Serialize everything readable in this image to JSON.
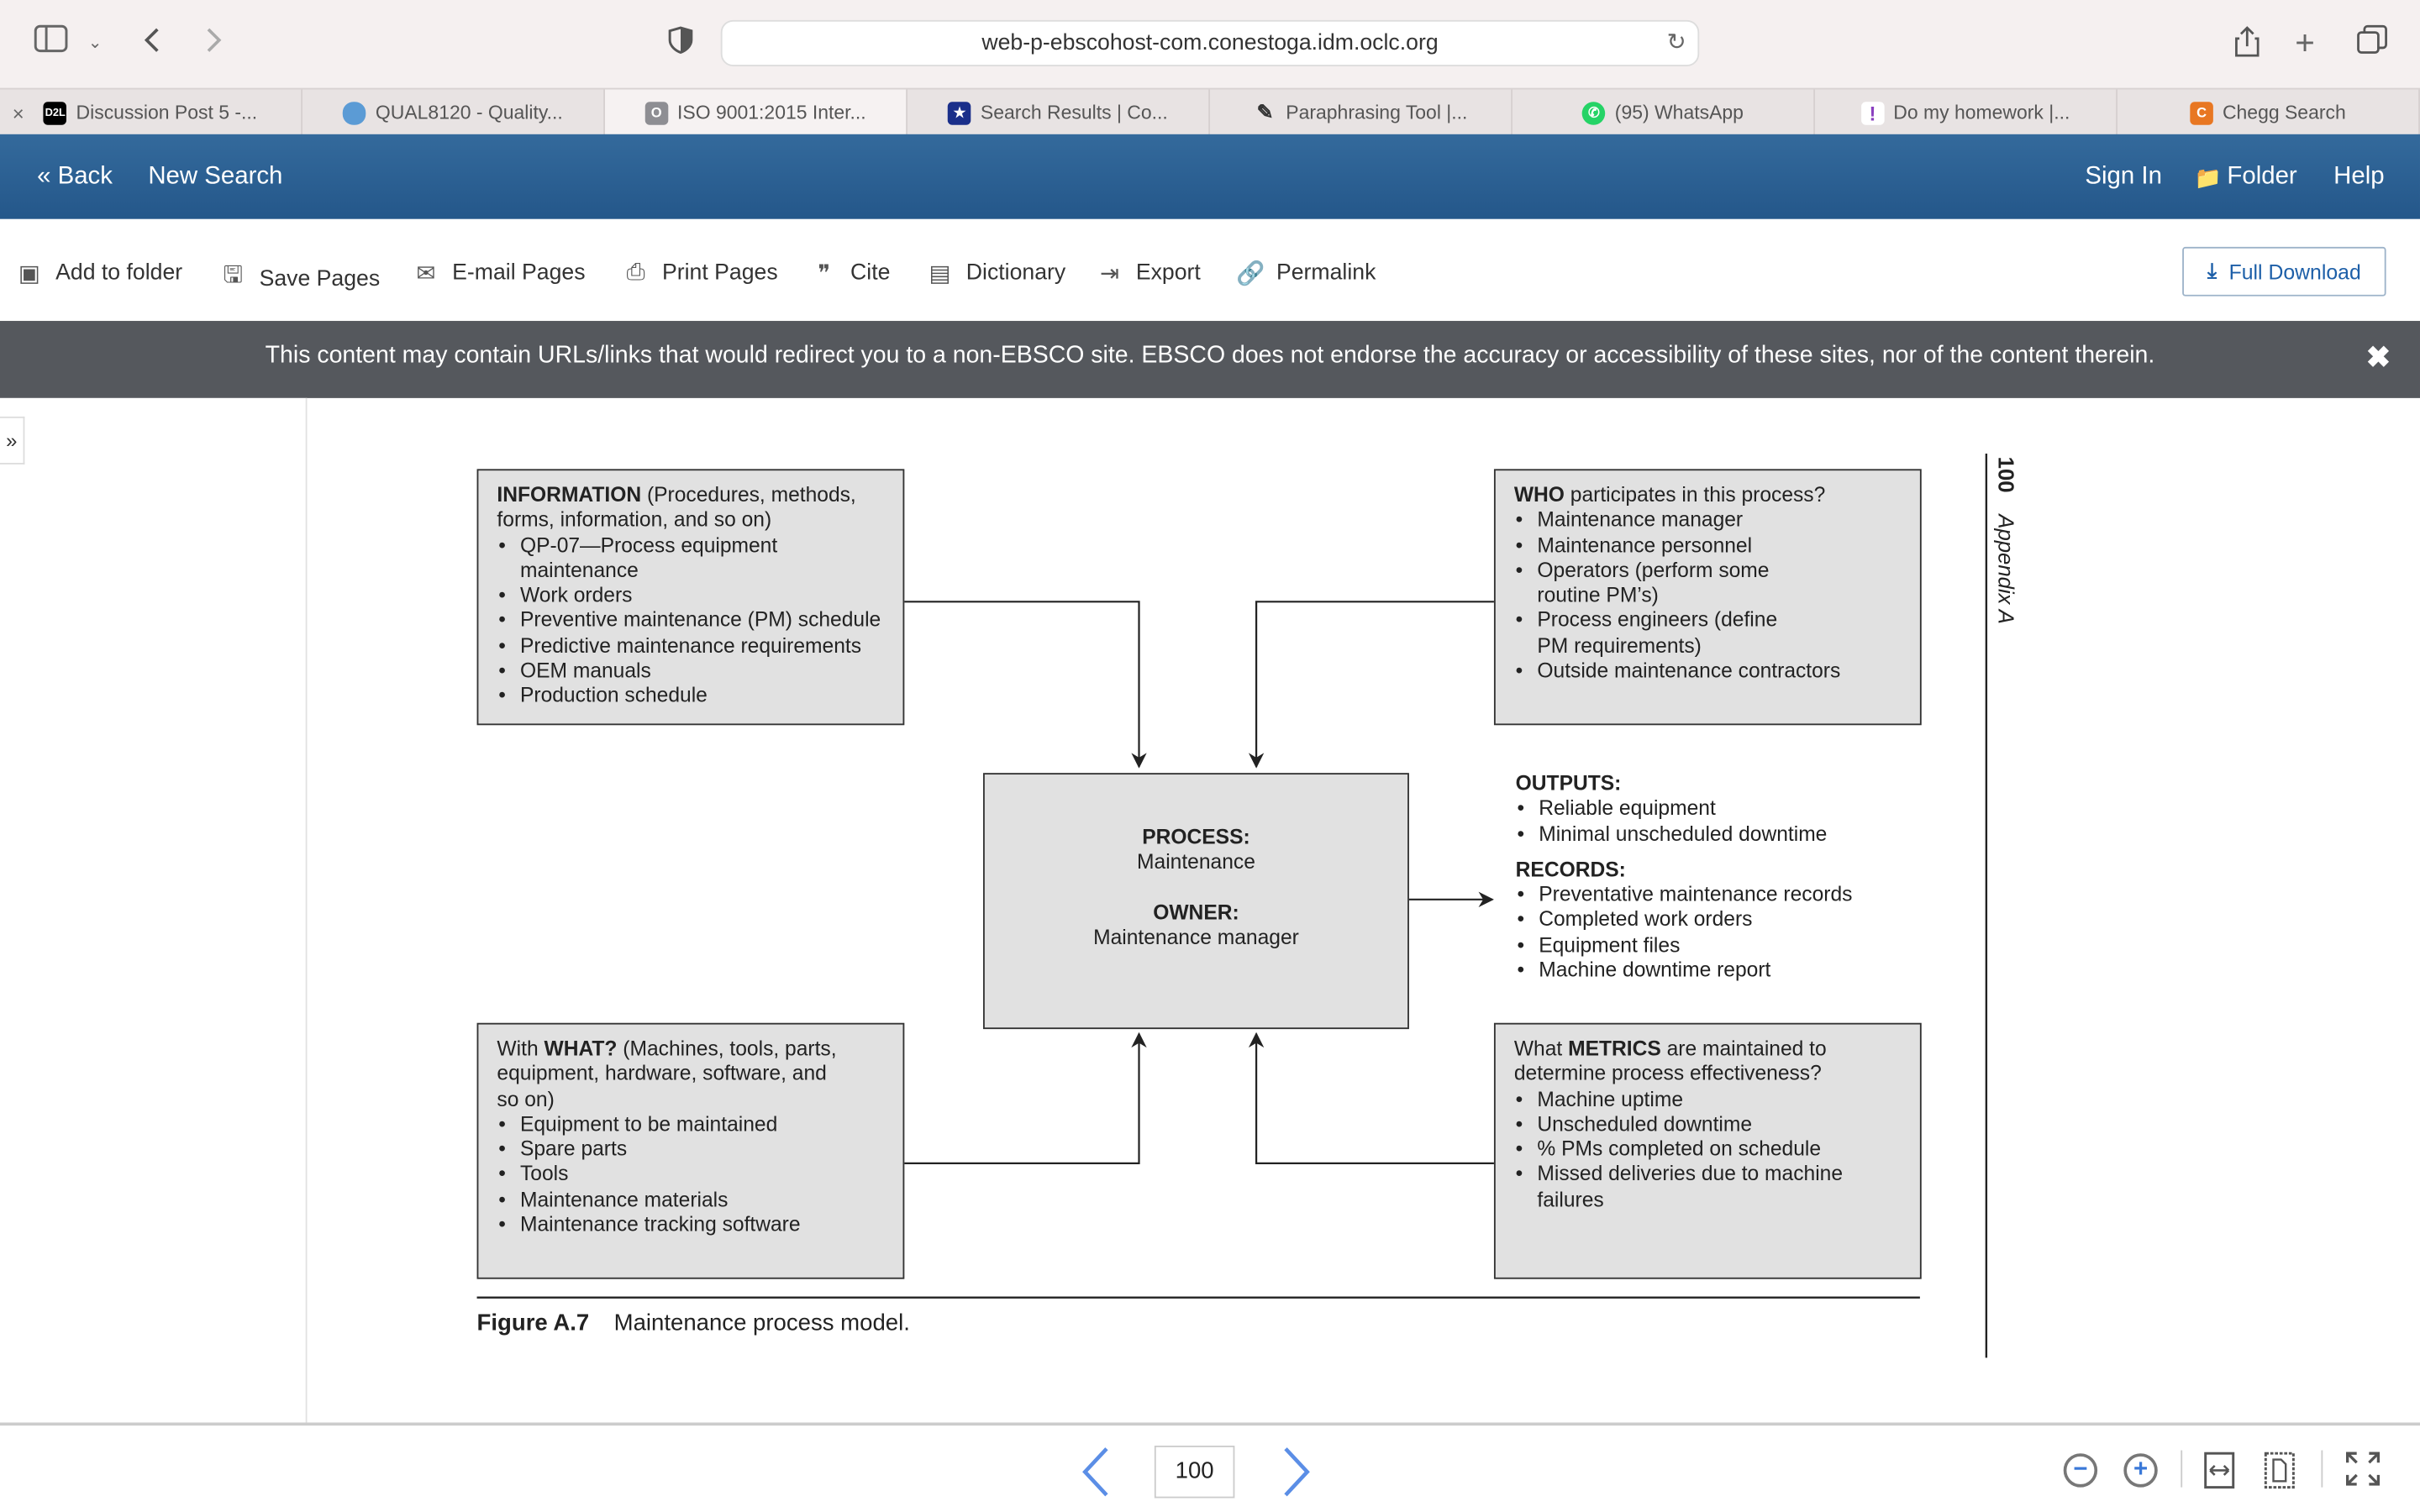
{
  "browser": {
    "url": "web-p-ebscohost-com.conestoga.idm.oclc.org",
    "tabs": [
      {
        "label": "Discussion Post 5 -...",
        "icon": "d2l-icon",
        "color": "#000000",
        "active": false
      },
      {
        "label": "QUAL8120 - Quality...",
        "icon": "cloud-icon",
        "color": "#5b9bd5",
        "active": false
      },
      {
        "label": "ISO 9001:2015 Inter...",
        "icon": "o-icon",
        "color": "#8e8e93",
        "active": true
      },
      {
        "label": "Search Results | Co...",
        "icon": "star-shield-icon",
        "color": "#1a2f8a",
        "active": false
      },
      {
        "label": "Paraphrasing Tool |...",
        "icon": "quill-icon",
        "color": "#333333",
        "active": false
      },
      {
        "label": "(95) WhatsApp",
        "icon": "whatsapp-icon",
        "color": "#25d366",
        "active": false
      },
      {
        "label": "Do my homework |...",
        "icon": "homework-icon",
        "color": "#8a3fbf",
        "active": false
      },
      {
        "label": "Chegg Search",
        "icon": "chegg-icon",
        "color": "#e87722",
        "active": false
      }
    ],
    "tab_close": "×"
  },
  "nav": {
    "back": "« Back",
    "new_search": "New Search",
    "sign_in": "Sign In",
    "folder": "Folder",
    "help": "Help"
  },
  "toolbar": {
    "items": [
      "Add to folder",
      "Save Pages",
      "E-mail Pages",
      "Print Pages",
      "Cite",
      "Dictionary",
      "Export",
      "Permalink"
    ],
    "full_download": "Full Download"
  },
  "banner": {
    "text": "This content may contain URLs/links that would redirect you to a non-EBSCO site. EBSCO does not endorse the accuracy or accessibility of these sites, nor of the content therein.",
    "close": "✖"
  },
  "sidebar": {
    "expand": "»"
  },
  "figure": {
    "information": {
      "heading": "INFORMATION",
      "subheading": " (Procedures, methods, forms, information, and so on)",
      "items": [
        "QP-07—Process equipment maintenance",
        "Work orders",
        "Preventive maintenance (PM) schedule",
        "Predictive maintenance requirements",
        "OEM manuals",
        "Production schedule"
      ]
    },
    "who": {
      "heading": "WHO",
      "subheading": " participates in this process?",
      "items": [
        "Maintenance manager",
        "Maintenance personnel",
        "Operators (perform some routine PM’s)",
        "Process engineers (define PM requirements)",
        "Outside maintenance contractors"
      ]
    },
    "process": {
      "process_label": "PROCESS:",
      "process_value": "Maintenance",
      "owner_label": "OWNER:",
      "owner_value": "Maintenance manager"
    },
    "outputs": {
      "heading": "OUTPUTS:",
      "items": [
        "Reliable equipment",
        "Minimal unscheduled downtime"
      ]
    },
    "records": {
      "heading": "RECORDS:",
      "items": [
        "Preventative maintenance records",
        "Completed work orders",
        "Equipment files",
        "Machine downtime report"
      ]
    },
    "what": {
      "prefix": "With ",
      "heading": "WHAT?",
      "subheading": " (Machines, tools, parts, equipment, hardware, software, and so on)",
      "items": [
        "Equipment to be maintained",
        "Spare parts",
        "Tools",
        "Maintenance materials",
        "Maintenance tracking software"
      ]
    },
    "metrics": {
      "prefix": "What ",
      "heading": "METRICS",
      "subheading": " are maintained to determine process effectiveness?",
      "items": [
        "Machine uptime",
        "Unscheduled downtime",
        "% PMs completed on schedule",
        "Missed deliveries due to machine failures"
      ]
    },
    "caption_label": "Figure A.7",
    "caption_text": "Maintenance process model.",
    "running_head_page": "100",
    "running_head_section": "Appendix A"
  },
  "pager": {
    "page": "100"
  }
}
